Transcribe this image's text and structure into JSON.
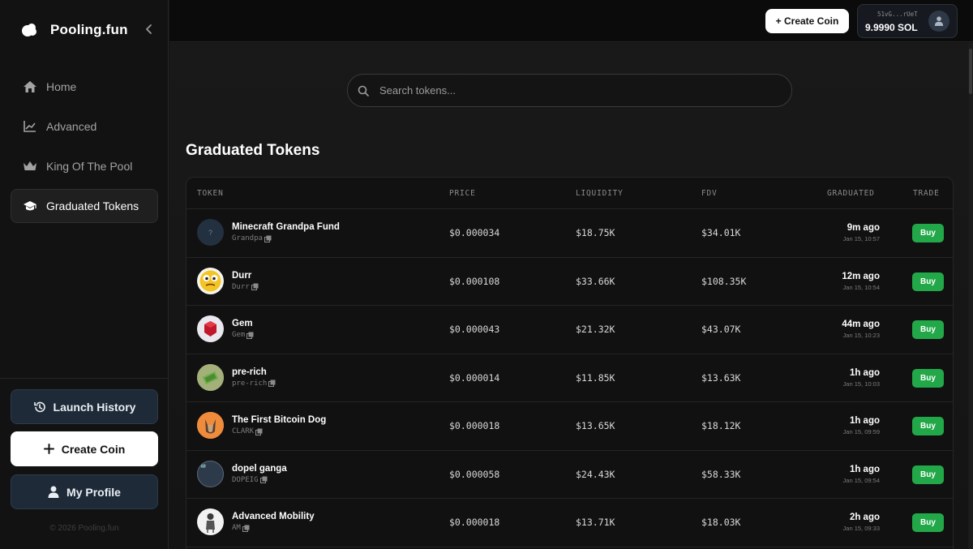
{
  "brand": {
    "name": "Pooling.fun"
  },
  "sidebar": {
    "items": [
      {
        "label": "Home",
        "icon": "home-icon"
      },
      {
        "label": "Advanced",
        "icon": "chart-line-icon"
      },
      {
        "label": "King Of The Pool",
        "icon": "crown-icon"
      },
      {
        "label": "Graduated Tokens",
        "icon": "graduation-cap-icon",
        "active": true
      }
    ],
    "launch_history_label": "Launch History",
    "create_coin_label": "Create Coin",
    "my_profile_label": "My Profile",
    "copyright": "© 2026 Pooling.fun"
  },
  "topbar": {
    "create_coin_label": "+ Create Coin",
    "wallet_address": "51vG...rUeT",
    "wallet_balance": "9.9990 SOL"
  },
  "search": {
    "placeholder": "Search tokens..."
  },
  "page": {
    "title": "Graduated Tokens"
  },
  "table": {
    "columns": [
      "TOKEN",
      "PRICE",
      "LIQUIDITY",
      "FDV",
      "GRADUATED",
      "TRADE"
    ],
    "buy_label": "Buy",
    "rows": [
      {
        "name": "Minecraft Grandpa Fund",
        "symbol": "Grandpa",
        "price": "$0.000034",
        "liquidity": "$18.75K",
        "fdv": "$34.01K",
        "graduated_ago": "9m ago",
        "graduated_date": "Jan 15, 10:57",
        "avatar_text": "?"
      },
      {
        "name": "Durr",
        "symbol": "Durr",
        "price": "$0.000108",
        "liquidity": "$33.66K",
        "fdv": "$108.35K",
        "graduated_ago": "12m ago",
        "graduated_date": "Jan 15, 10:54"
      },
      {
        "name": "Gem",
        "symbol": "Gem",
        "price": "$0.000043",
        "liquidity": "$21.32K",
        "fdv": "$43.07K",
        "graduated_ago": "44m ago",
        "graduated_date": "Jan 15, 10:23"
      },
      {
        "name": "pre-rich",
        "symbol": "pre-rich",
        "price": "$0.000014",
        "liquidity": "$11.85K",
        "fdv": "$13.63K",
        "graduated_ago": "1h ago",
        "graduated_date": "Jan 15, 10:03"
      },
      {
        "name": "The First Bitcoin Dog",
        "symbol": "CLARK",
        "price": "$0.000018",
        "liquidity": "$13.65K",
        "fdv": "$18.12K",
        "graduated_ago": "1h ago",
        "graduated_date": "Jan 15, 09:59"
      },
      {
        "name": "dopel ganga",
        "symbol": "DOPEIG",
        "price": "$0.000058",
        "liquidity": "$24.43K",
        "fdv": "$58.33K",
        "graduated_ago": "1h ago",
        "graduated_date": "Jan 15, 09:54"
      },
      {
        "name": "Advanced Mobility",
        "symbol": "AM",
        "price": "$0.000018",
        "liquidity": "$13.71K",
        "fdv": "$18.03K",
        "graduated_ago": "2h ago",
        "graduated_date": "Jan 15, 09:33"
      }
    ]
  },
  "colors": {
    "buy_green": "#22a848",
    "panel_blue": "#1e2a38",
    "background": "#151515"
  }
}
